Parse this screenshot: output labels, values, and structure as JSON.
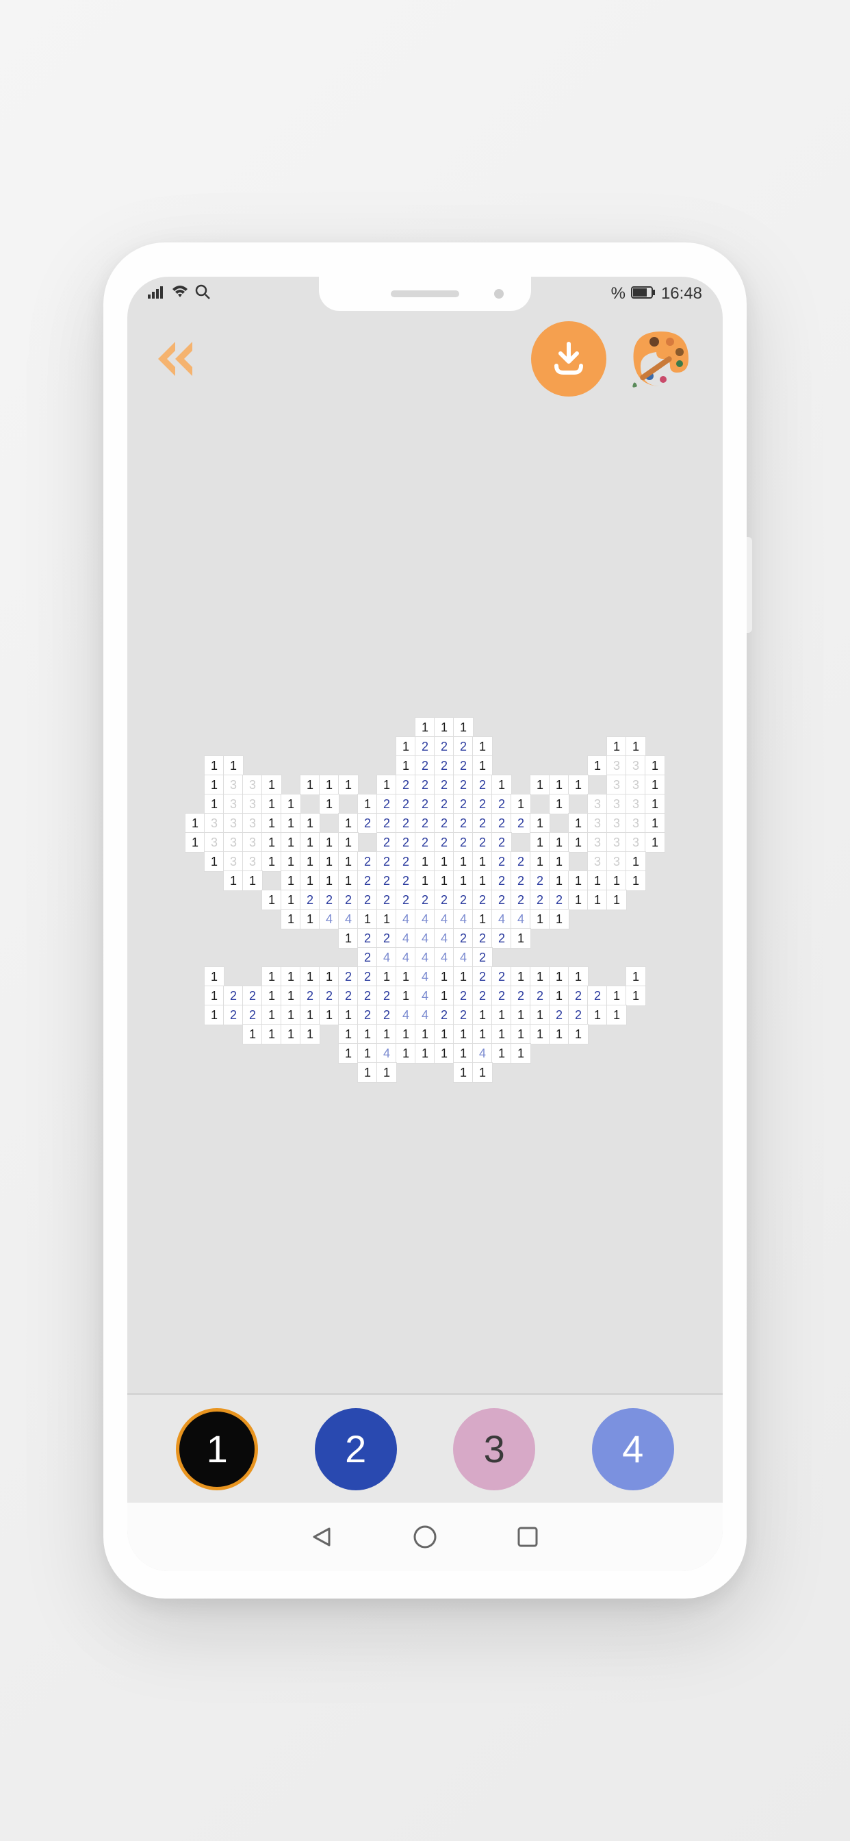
{
  "status_bar": {
    "time": "16:48",
    "battery_suffix": "%"
  },
  "header": {
    "back_icon": "back-double-chevron",
    "download_icon": "download",
    "palette_icon": "palette"
  },
  "colors": [
    {
      "num": "1",
      "hex": "#090909",
      "text": "#ffffff",
      "selected": true
    },
    {
      "num": "2",
      "hex": "#2949b0",
      "text": "#ffffff",
      "selected": false
    },
    {
      "num": "3",
      "hex": "#d7a9c7",
      "text": "#3a3a3a",
      "selected": false
    },
    {
      "num": "4",
      "hex": "#7b91df",
      "text": "#ffffff",
      "selected": false
    }
  ],
  "pixel_grid": {
    "cols": 25,
    "rows": 19,
    "rows_data": [
      "            111          ",
      "           12221      11 ",
      " 11        12221     1331",
      " 1331 111 1222221 111 331",
      " 13311 1 122222221 1 3331",
      "1333111 12222222221 13331",
      "133311111 2222222 1113331",
      " 1331111122211112211 331 ",
      "  11 1111222111122211111 ",
      "    1122222222222222111  ",
      "     114411444414411     ",
      "        1224442221       ",
      "         2444442         ",
      " 1  11112211411221111  1 ",
      " 12211222221412222212211 ",
      " 1221111122442211112211  ",
      "   1111 1111111111111    ",
      "        1141111411       ",
      "         11   11         "
    ]
  },
  "nav": {
    "back": "triangle-left",
    "home": "circle",
    "recent": "square"
  }
}
